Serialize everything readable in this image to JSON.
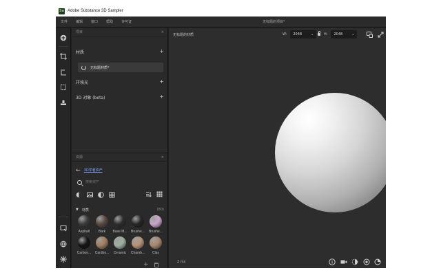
{
  "window": {
    "title": "Adobe Substance 3D Sampler",
    "logo_text": "Sa"
  },
  "menu": {
    "items": [
      "文件",
      "编辑",
      "窗口",
      "帮助",
      "许可证"
    ],
    "document_title": "无标题的项目*"
  },
  "left_toolbar": {
    "icons": [
      "add-icon",
      "crop-icon",
      "measure-icon",
      "frame-icon",
      "stamp-icon",
      "screen-icon",
      "globe-icon",
      "sparkle-icon"
    ]
  },
  "project_panel": {
    "header": "项目",
    "sections": [
      {
        "label": "材质"
      },
      {
        "label": "环境光"
      },
      {
        "label": "3D 对象 (beta)"
      }
    ],
    "current_material": "无标题材质*"
  },
  "assets_panel": {
    "header": "资源",
    "back_label": "3D学者资产",
    "search_placeholder": "搜索资产",
    "category": {
      "name": "材质",
      "count": "(80)"
    },
    "thumbnails": [
      {
        "label": "Asphalt",
        "color": "#3b3b3b"
      },
      {
        "label": "Bark",
        "color": "#5a4a40"
      },
      {
        "label": "Base M...",
        "color": "#2e2e2e"
      },
      {
        "label": "Brushe...",
        "color": "#262626"
      },
      {
        "label": "Brushe...",
        "color": "#c9a6c9"
      },
      {
        "label": "Carbon...",
        "color": "#151515"
      },
      {
        "label": "Cardbo...",
        "color": "#a27e5e"
      },
      {
        "label": "Ceramic",
        "color": "#9fb09f"
      },
      {
        "label": "Chamb...",
        "color": "#b89376"
      },
      {
        "label": "Clay",
        "color": "#a8876c"
      }
    ]
  },
  "viewport": {
    "title": "无标题的材质",
    "width_label": "W:",
    "width_value": "2048",
    "height_label": "H:",
    "height_value": "2048",
    "frame_time": "2 ms"
  }
}
